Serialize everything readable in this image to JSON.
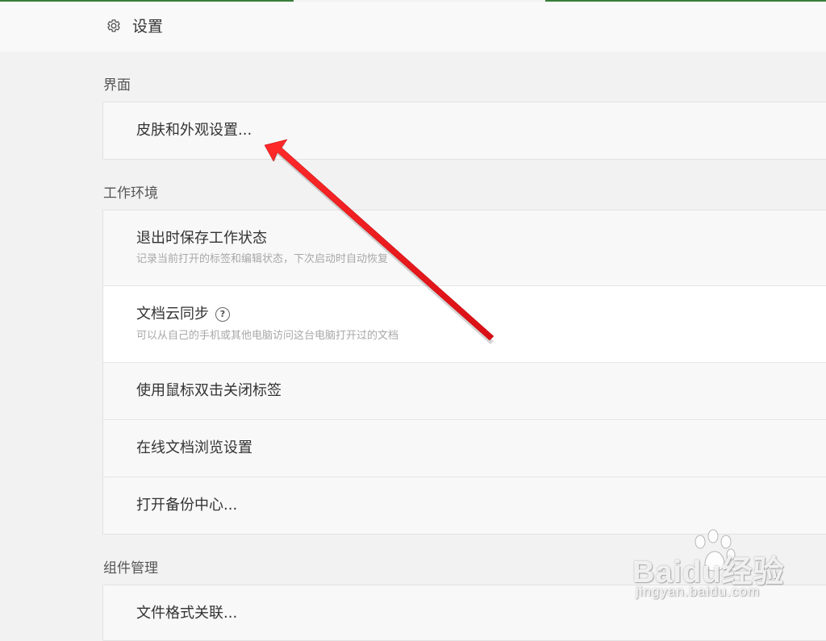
{
  "header": {
    "title": "设置",
    "icon": "gear-icon"
  },
  "sections": {
    "interface": {
      "label": "界面",
      "items": [
        {
          "label": "皮肤和外观设置..."
        }
      ]
    },
    "workspace": {
      "label": "工作环境",
      "items": [
        {
          "label": "退出时保存工作状态",
          "sub": "记录当前打开的标签和编辑状态，下次启动时自动恢复"
        },
        {
          "label": "文档云同步",
          "sub": "可以从自己的手机或其他电脑访问这台电脑打开过的文档",
          "help": "?"
        },
        {
          "label": "使用鼠标双击关闭标签"
        },
        {
          "label": "在线文档浏览设置"
        },
        {
          "label": "打开备份中心..."
        }
      ]
    },
    "components": {
      "label": "组件管理",
      "items": [
        {
          "label": "文件格式关联..."
        }
      ]
    }
  },
  "watermark": {
    "brand": "Baidu经验",
    "url": "jingyan.baidu.com"
  },
  "colors": {
    "background": "#f2f2f2",
    "card": "#f8f8f8",
    "arrow": "#e8141b",
    "accent_strip": "#3a7d3a"
  }
}
